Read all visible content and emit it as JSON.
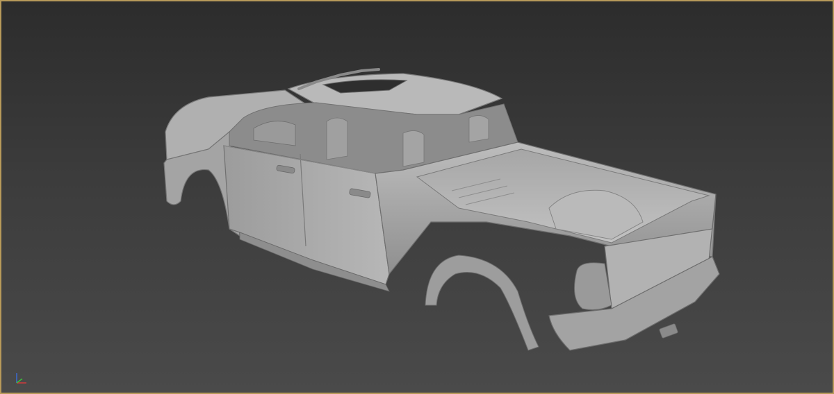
{
  "viewport": {
    "active_border_color": "#b89a5a",
    "background_top": "#2c2c2c",
    "background_bottom": "#4a4a4a",
    "model_color": "#a9a9a9"
  },
  "model": {
    "icon": "pickup-truck-model-icon"
  },
  "gizmo": {
    "icon": "axis-tripod-icon",
    "x_color": "#d23a3a",
    "y_color": "#3ac23a",
    "z_color": "#3a6ad2"
  }
}
